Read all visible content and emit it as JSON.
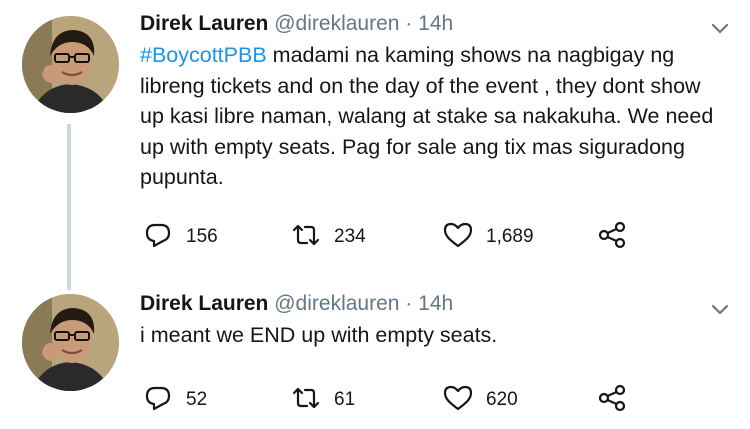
{
  "tweets": [
    {
      "display_name": "Direk Lauren",
      "handle": "@direklauren",
      "separator": "·",
      "time": "14h",
      "hashtag": "#BoycottPBB",
      "text": " madami na kaming shows na nagbigay ng libreng tickets and on the day of the event , they dont show up kasi libre naman, walang at stake sa nakakuha. We need up with empty seats.  Pag for sale ang tix mas siguradong pupunta.",
      "replies": "156",
      "retweets": "234",
      "likes": "1,689"
    },
    {
      "display_name": "Direk Lauren",
      "handle": "@direklauren",
      "separator": "·",
      "time": "14h",
      "text": "i meant we END up with empty seats.",
      "replies": "52",
      "retweets": "61",
      "likes": "620"
    }
  ],
  "icons": {
    "reply": "reply-icon",
    "retweet": "retweet-icon",
    "like": "heart-icon",
    "share": "share-icon",
    "caret": "chevron-down-icon"
  },
  "colors": {
    "hashtag": "#1b95e0",
    "secondary_text": "#657786",
    "icon": "#14171a",
    "thread_line": "#ccd6dd"
  }
}
